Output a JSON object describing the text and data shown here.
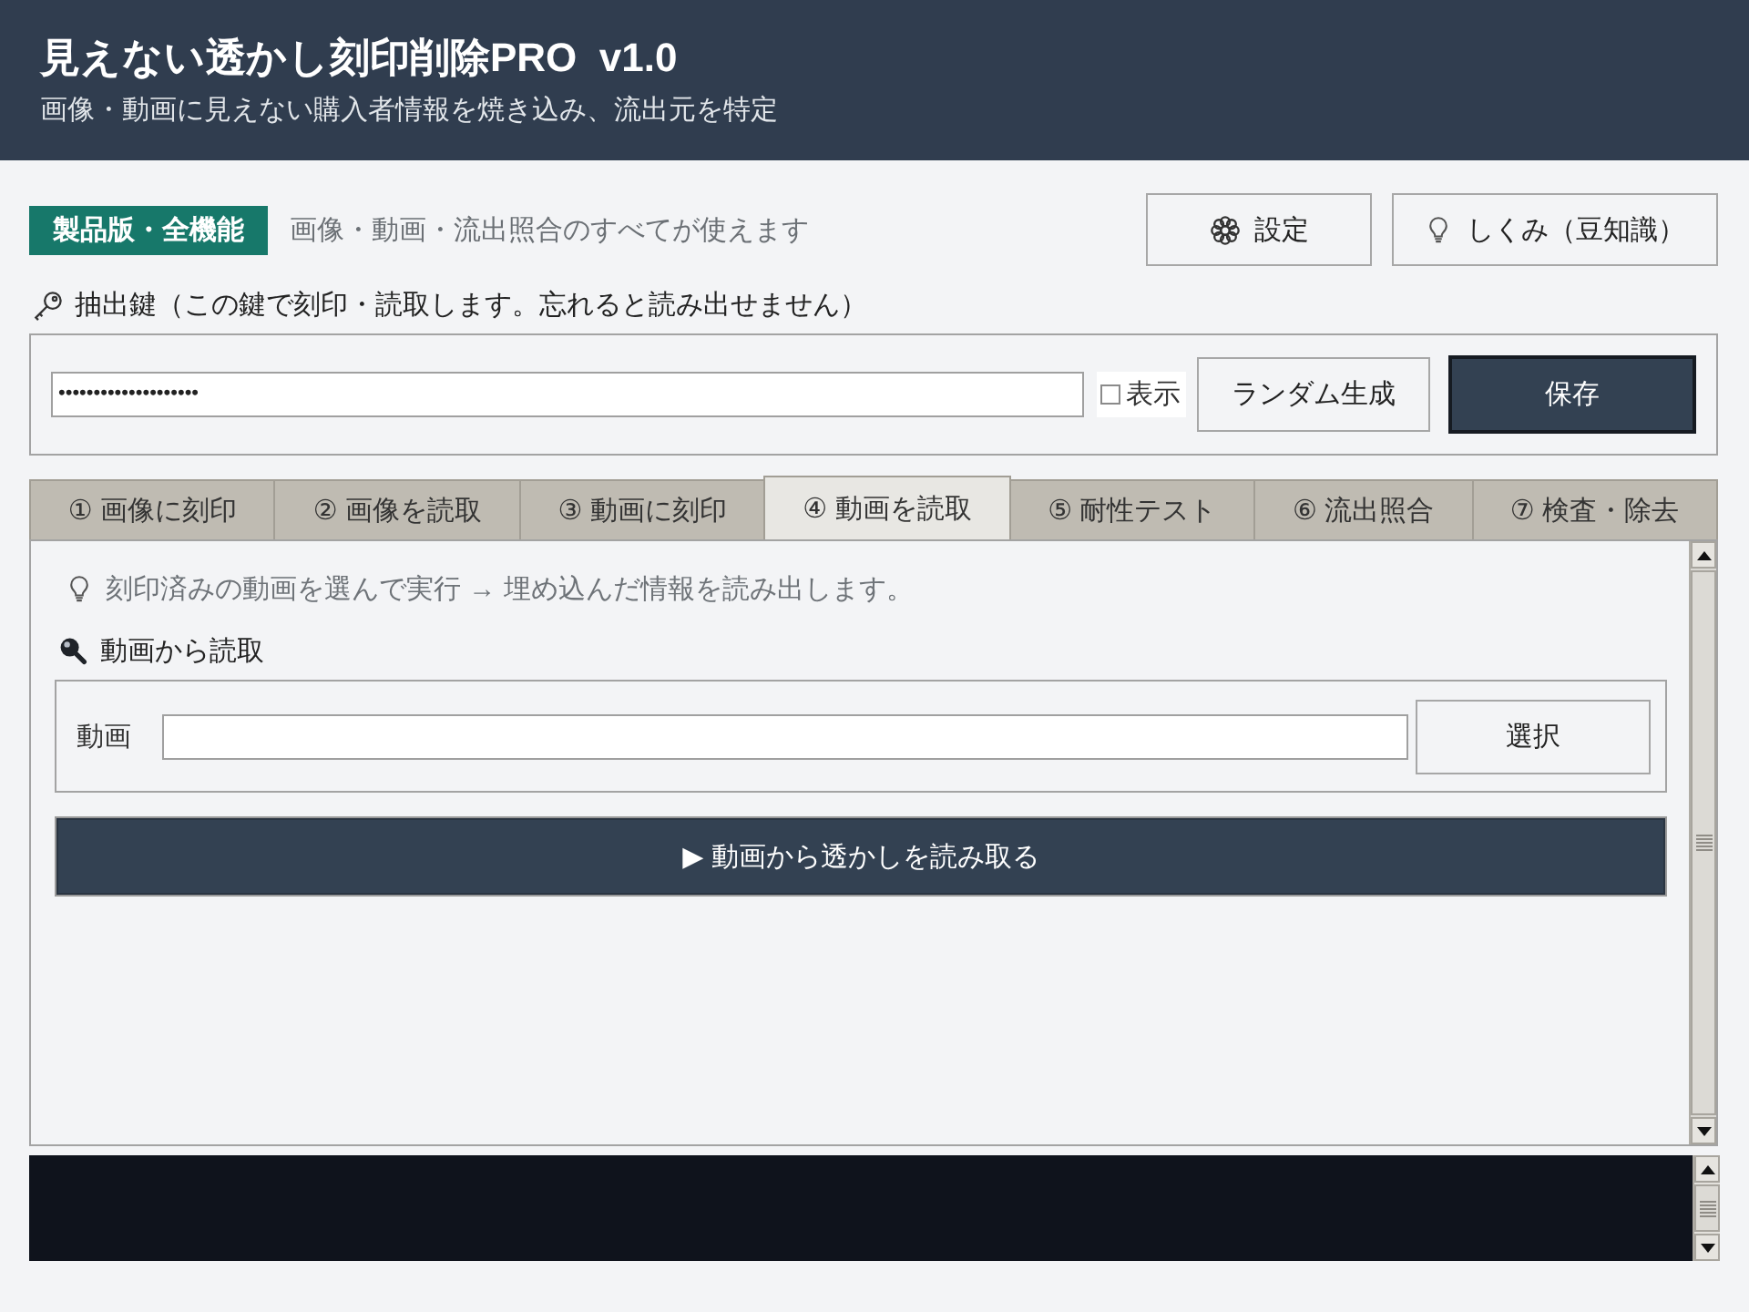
{
  "header": {
    "title": "見えない透かし刻印削除PRO  v1.0",
    "subtitle": "画像・動画に見えない購入者情報を焼き込み、流出元を特定"
  },
  "license": {
    "badge": "製品版・全機能",
    "note": "画像・動画・流出照合のすべてが使えます"
  },
  "toolbar_buttons": [
    {
      "kind": "settings",
      "label": "設定"
    },
    {
      "kind": "tips",
      "label": "しくみ（豆知識）"
    }
  ],
  "key": {
    "label": "抽出鍵（この鍵で刻印・読取します。忘れると読み出せません）",
    "value": "••••••••••••••••••••",
    "show": {
      "label": "表示",
      "checked": false
    },
    "buttons": [
      {
        "kind": "random",
        "label": "ランダム生成"
      },
      {
        "kind": "save",
        "label": "保存"
      }
    ]
  },
  "tabs": [
    {
      "label": "① 画像に刻印",
      "selected": false
    },
    {
      "label": "② 画像を読取",
      "selected": false
    },
    {
      "label": "③ 動画に刻印",
      "selected": false
    },
    {
      "label": "④ 動画を読取",
      "selected": true
    },
    {
      "label": "⑤ 耐性テスト",
      "selected": false
    },
    {
      "label": "⑥ 流出照合",
      "selected": false
    },
    {
      "label": "⑦ 検査・除去",
      "selected": false
    }
  ],
  "panel": {
    "hint": "刻印済みの動画を選んで実行 → 埋め込んだ情報を読み出します。",
    "section": "動画から読取",
    "field": {
      "label": "動画"
    },
    "select_button": "選択",
    "run_button": "▶ 動画から透かしを読み取る"
  }
}
